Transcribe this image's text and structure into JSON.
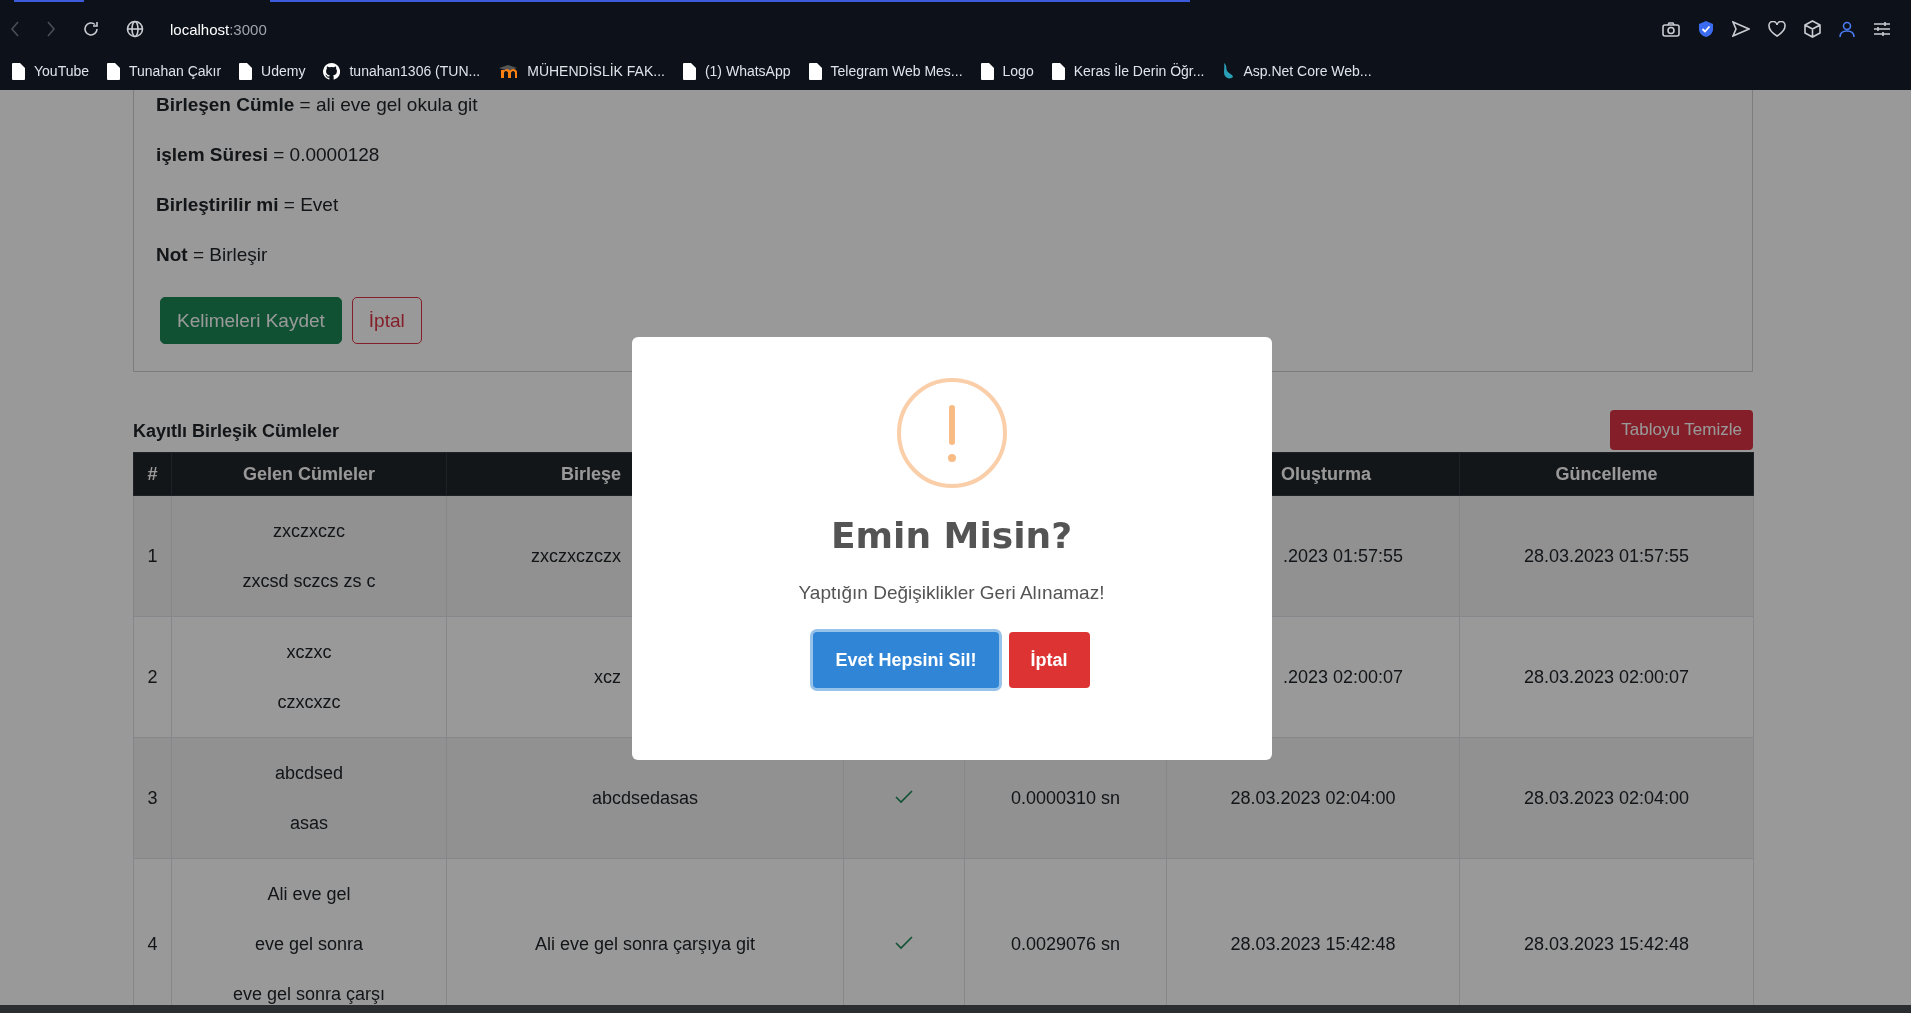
{
  "browser": {
    "url_host": "localhost",
    "url_port": ":3000",
    "bookmarks": [
      {
        "kind": "page",
        "label": "YouTube"
      },
      {
        "kind": "page",
        "label": "Tunahan Çakır"
      },
      {
        "kind": "page",
        "label": "Udemy"
      },
      {
        "kind": "github",
        "label": "tunahan1306 (TUN..."
      },
      {
        "kind": "moodle",
        "label": "MÜHENDİSLİK FAK..."
      },
      {
        "kind": "page",
        "label": "(1) WhatsApp"
      },
      {
        "kind": "page",
        "label": "Telegram Web Mes..."
      },
      {
        "kind": "page",
        "label": "Logo"
      },
      {
        "kind": "page",
        "label": "Keras İle Derin Öğr..."
      },
      {
        "kind": "dotnet",
        "label": "Asp.Net Core Web..."
      }
    ]
  },
  "result": {
    "fields": [
      "**Birleşen Cümle** = ali eve gel okula git",
      "**işlem Süresi** = 0.0000128",
      "**Birleştirilir mi** = Evet",
      "**Not** = Birleşir"
    ],
    "buttons": [
      {
        "kind": "primary",
        "label": "Kelimeleri Kaydet"
      },
      {
        "kind": "outline",
        "label": "İptal"
      }
    ]
  },
  "saved": {
    "title": "Kayıtlı Birleşik Cümleler",
    "clear_button": "Tabloyu Temizle",
    "columns": [
      "#",
      "Gelen Cümleler",
      "Birleşe",
      "Oluşturma",
      "Güncelleme"
    ],
    "rows": [
      {
        "number": "1",
        "inputs": [
          "zxczxczc",
          "zxcsd sczcs zs c"
        ],
        "merged_text": "zxczxczczx",
        "created": ".2023 01:57:55",
        "updated": "28.03.2023 01:57:55"
      },
      {
        "number": "2",
        "inputs": [
          "xczxc",
          "czxcxzc"
        ],
        "merged_text": "xcz",
        "created": ".2023 02:00:07",
        "updated": "28.03.2023 02:00:07"
      },
      {
        "number": "3",
        "inputs": [
          "abcdsed",
          "asas"
        ],
        "merged_text": "abcdsedasas",
        "merged": true,
        "duration": "0.0000310 sn",
        "created": "28.03.2023 02:04:00",
        "updated": "28.03.2023 02:04:00"
      },
      {
        "number": "4",
        "inputs": [
          "Ali eve gel",
          "eve gel sonra",
          "eve gel sonra çarşı"
        ],
        "merged_text": "Ali eve gel sonra çarşıya git",
        "merged": true,
        "duration": "0.0029076 sn",
        "created": "28.03.2023 15:42:48",
        "updated": "28.03.2023 15:42:48"
      }
    ]
  },
  "dialog": {
    "title": "Emin Misin?",
    "text": "Yaptığın Değişiklikler Geri Alınamaz!",
    "buttons": [
      {
        "kind": "confirm",
        "label": "Evet Hepsini Sil!",
        "focused": true
      },
      {
        "kind": "cancel",
        "label": "İptal",
        "focused": false
      }
    ]
  }
}
